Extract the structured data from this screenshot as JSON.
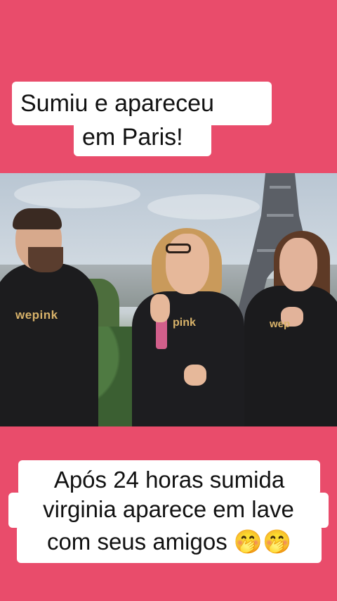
{
  "top_caption": {
    "line1": "Sumiu e apareceu",
    "line2": "em Paris!"
  },
  "video": {
    "brand_text_left": "wepink",
    "brand_text_center": "pink",
    "brand_text_right": "wep"
  },
  "bottom_caption": {
    "line1": "Após 24 horas sumida",
    "line2": "virginia aparece em lave",
    "line3": "com seus amigos 🤭🤭"
  },
  "colors": {
    "background": "#e94c6b",
    "caption_box": "#ffffff",
    "brand_gold": "#d9b36a"
  }
}
